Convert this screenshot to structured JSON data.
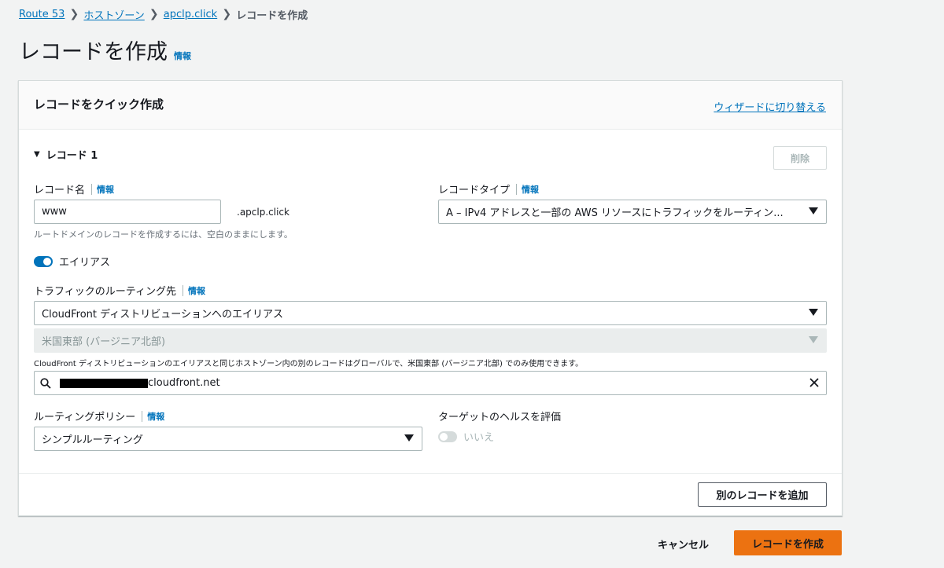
{
  "breadcrumb": {
    "items": [
      "Route 53",
      "ホストゾーン",
      "apclp.click"
    ],
    "current": "レコードを作成"
  },
  "page": {
    "title": "レコードを作成",
    "info": "情報"
  },
  "panel": {
    "title": "レコードをクイック作成",
    "switch_wizard": "ウィザードに切り替える"
  },
  "record": {
    "heading": "レコード 1",
    "delete_label": "削除",
    "name_label": "レコード名",
    "info": "情報",
    "name_value": "www",
    "name_suffix": ".apclp.click",
    "name_help": "ルートドメインのレコードを作成するには、空白のままにします。",
    "type_label": "レコードタイプ",
    "type_value": "A – IPv4 アドレスと一部の AWS リソースにトラフィックをルーティン...",
    "alias_label": "エイリアス",
    "alias_on": true,
    "route_to_label": "トラフィックのルーティング先",
    "route_to_value": "CloudFront ディストリビューションへのエイリアス",
    "region_value": "米国東部 (バージニア北部)",
    "region_help": "CloudFront ディストリビューションのエイリアスと同じホストゾーン内の別のレコードはグローバルで、米国東部 (バージニア北部) でのみ使用できます。",
    "distribution_suffix": "cloudfront.net",
    "routing_policy_label": "ルーティングポリシー",
    "routing_policy_value": "シンプルルーティング",
    "health_label": "ターゲットのヘルスを評価",
    "health_value": "いいえ"
  },
  "actions": {
    "add_record": "別のレコードを追加",
    "cancel": "キャンセル",
    "create": "レコードを作成"
  },
  "colors": {
    "accent": "#0073bb",
    "primary": "#ec7211",
    "background": "#f2f3f3"
  }
}
